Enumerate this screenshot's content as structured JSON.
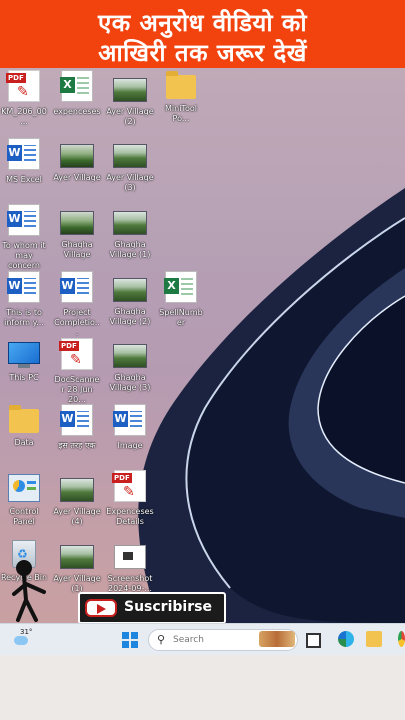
{
  "banner": {
    "line1": "एक अनुरोध वीडियो को",
    "line2": "आखिरी तक जरूर देखें"
  },
  "desktop": {
    "icons": [
      {
        "label": "KM_206_00...",
        "type": "pdf-icon"
      },
      {
        "label": "expenceses",
        "type": "excel-icon"
      },
      {
        "label": "Ayer Village (2)",
        "type": "image-icon"
      },
      {
        "label": "MiniTool Po...",
        "type": "folder-icon"
      },
      {
        "label": "MS Excel",
        "type": "word-icon"
      },
      {
        "label": "Ayer Village",
        "type": "video-icon"
      },
      {
        "label": "Ayer Village (3)",
        "type": "image-icon"
      },
      {
        "label": "To whom it may concern",
        "type": "word-icon"
      },
      {
        "label": "Ghagha Village",
        "type": "video-icon"
      },
      {
        "label": "Ghagha Village (1)",
        "type": "image-icon"
      },
      {
        "label": "This is to inform y...",
        "type": "word-icon"
      },
      {
        "label": "Project Completio...",
        "type": "word-icon"
      },
      {
        "label": "Ghagha Village (2)",
        "type": "image-icon"
      },
      {
        "label": "SpellNumber",
        "type": "excel-icon"
      },
      {
        "label": "This PC",
        "type": "monitor-icon"
      },
      {
        "label": "DocScanner 28 Jun 20...",
        "type": "pdf-icon"
      },
      {
        "label": "Ghagha Village (3)",
        "type": "image-icon"
      },
      {
        "label": "Data",
        "type": "folder-icon"
      },
      {
        "label": "इस तरह एक",
        "type": "word-icon"
      },
      {
        "label": "Image",
        "type": "word-icon"
      },
      {
        "label": "Control Panel",
        "type": "control-panel-icon"
      },
      {
        "label": "Ayer Village (4)",
        "type": "image-icon"
      },
      {
        "label": "Expenceses Details",
        "type": "pdf-icon"
      },
      {
        "label": "Recycle Bin",
        "type": "recycle-bin-icon"
      },
      {
        "label": "Ayer Village (1)",
        "type": "image-icon"
      },
      {
        "label": "Screenshot 2024-09-...",
        "type": "screenshot-icon"
      }
    ]
  },
  "overlay": {
    "subscribe_text": "Suscribirse"
  },
  "taskbar": {
    "weather_temp": "31°",
    "search_placeholder": "Search"
  }
}
